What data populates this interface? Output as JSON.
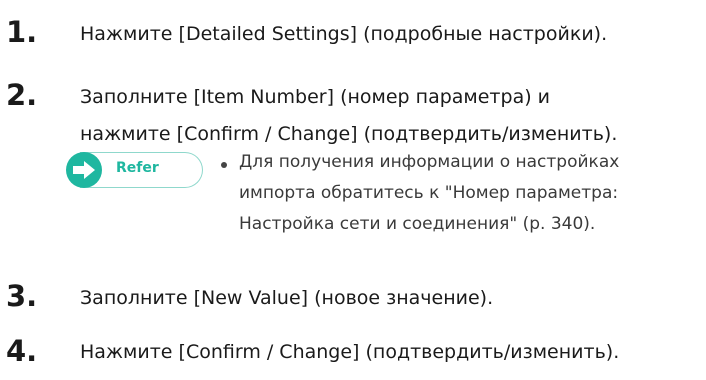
{
  "steps": [
    {
      "number": "1.",
      "lines": [
        "Нажмите [Detailed Settings] (подробные настройки)."
      ]
    },
    {
      "number": "2.",
      "lines": [
        "Заполните [Item Number] (номер параметра) и",
        "нажмите [Confirm / Change] (подтвердить/изменить)."
      ]
    },
    {
      "number": "3.",
      "lines": [
        "Заполните [New Value] (новое значение)."
      ]
    },
    {
      "number": "4.",
      "lines": [
        "Нажмите [Confirm / Change] (подтвердить/изменить)."
      ]
    }
  ],
  "refer": {
    "label": "Refer",
    "icon": "arrow-right-icon",
    "bullet_lines": [
      "Для получения информации о настройках",
      "импорта обратитесь к \"Номер параметра:",
      "Настройка сети и соединения\" (р. 340)."
    ]
  },
  "colors": {
    "accent": "#1fb7a0",
    "text": "#1a1a1a"
  }
}
